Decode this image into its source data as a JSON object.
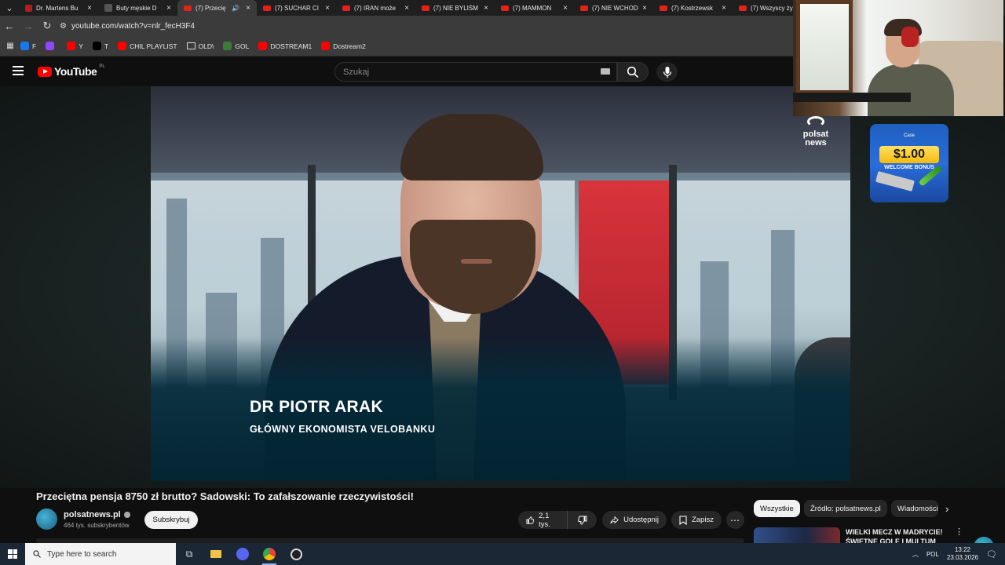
{
  "browser": {
    "tabs": [
      {
        "title": "Dr. Martens Bu",
        "active": false
      },
      {
        "title": "Buty męskie D",
        "active": false
      },
      {
        "title": "(7) Przecię",
        "active": true
      },
      {
        "title": "(7) SUCHAR CI",
        "active": false
      },
      {
        "title": "(7) IRAN może",
        "active": false
      },
      {
        "title": "(7) NIE BYLIŚM",
        "active": false
      },
      {
        "title": "(7) MAMMON",
        "active": false
      },
      {
        "title": "(7) NIE WCHOD",
        "active": false
      },
      {
        "title": "(7) Kostrzewsk",
        "active": false
      },
      {
        "title": "(7) Wszyscy ży",
        "active": false
      }
    ],
    "url": "youtube.com/watch?v=nlr_fecH3F4",
    "bookmarks": [
      {
        "label": "F",
        "icon": "facebook-icon",
        "color": "#1877f2"
      },
      {
        "label": "",
        "icon": "twitch-icon",
        "color": "#9146ff"
      },
      {
        "label": "Y",
        "icon": "youtube-icon",
        "color": "#ff0000"
      },
      {
        "label": "T",
        "icon": "x-icon",
        "color": "#000000"
      },
      {
        "label": "CHIL PLAYLIST",
        "icon": "youtube-icon",
        "color": "#ff0000"
      },
      {
        "label": "OLD\\",
        "icon": "folder-icon",
        "color": "#3b3b3b"
      },
      {
        "label": "GOL",
        "icon": "gol-icon",
        "color": "#3a7b3a"
      },
      {
        "label": "DOSTREAM1",
        "icon": "youtube-icon",
        "color": "#ff0000"
      },
      {
        "label": "Dostream2",
        "icon": "youtube-icon",
        "color": "#ff0000"
      }
    ]
  },
  "youtube": {
    "logo_text": "YouTube",
    "country_code": "PL",
    "search_placeholder": "Szukaj"
  },
  "video": {
    "lower_third_name": "DR PIOTR ARAK",
    "lower_third_role": "GŁÓWNY EKONOMISTA VELOBANKU",
    "watermark_line1": "polsat",
    "watermark_line2": "news",
    "title": "Przeciętna pensja 8750 zł brutto? Sadowski: To zafałszowanie rzeczywistości!",
    "channel": "polsatnews.pl",
    "subscribers": "464 tys. subskrybentów",
    "subscribe_label": "Subskrybuj",
    "likes": "2,1 tys.",
    "share_label": "Udostępnij",
    "save_label": "Zapisz"
  },
  "ad": {
    "brand": "Case",
    "amount": "$1.00",
    "subtitle": "WELCOME BONUS"
  },
  "sidebar": {
    "chips": [
      "Wszystkie",
      "Źródło: polsatnews.pl",
      "Wiadomości"
    ],
    "recommendation_title": "WIELKI MECZ W MADRYCIE! ŚWIETNE GOLE I MULTUM"
  },
  "taskbar": {
    "search_placeholder": "Type here to search",
    "language": "POL",
    "time": "13:22",
    "date": "23.03.2026"
  }
}
